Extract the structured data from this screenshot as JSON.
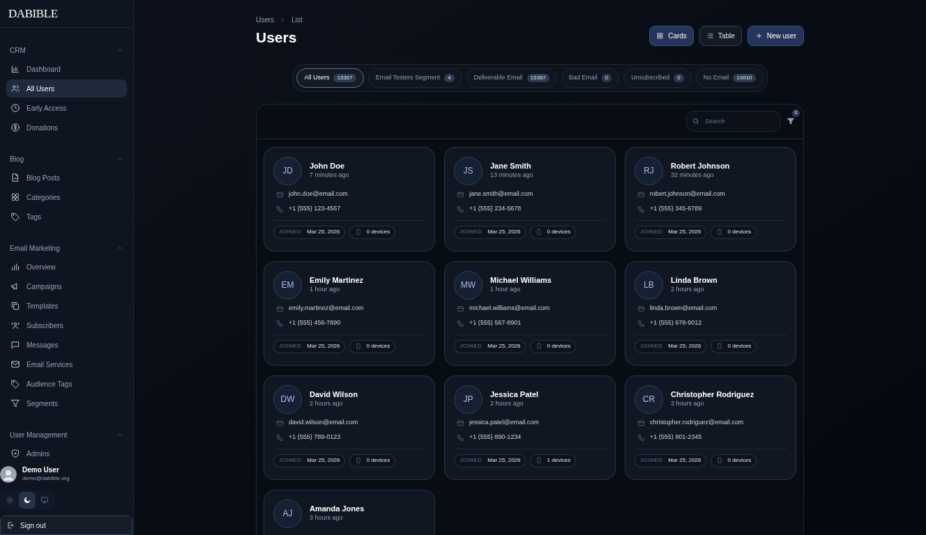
{
  "sidebar": {
    "logo": "DABIBLE",
    "sections": [
      {
        "title": "CRM",
        "expanded": true,
        "items": [
          {
            "label": "Dashboard",
            "selected": false
          },
          {
            "label": "All Users",
            "selected": true
          },
          {
            "label": "Early Access",
            "selected": false
          },
          {
            "label": "Donations",
            "selected": false
          }
        ]
      },
      {
        "title": "Blog",
        "expanded": true,
        "items": [
          {
            "label": "Blog Posts",
            "selected": false
          },
          {
            "label": "Categories",
            "selected": false
          },
          {
            "label": "Tags",
            "selected": false
          }
        ]
      },
      {
        "title": "Email Marketing",
        "expanded": true,
        "items": [
          {
            "label": "Overview",
            "selected": false
          },
          {
            "label": "Campaigns",
            "selected": false
          },
          {
            "label": "Templates",
            "selected": false
          },
          {
            "label": "Subscribers",
            "selected": false
          },
          {
            "label": "Messages",
            "selected": false
          },
          {
            "label": "Email Services",
            "selected": false
          },
          {
            "label": "Audience Tags",
            "selected": false
          },
          {
            "label": "Segments",
            "selected": false
          }
        ]
      },
      {
        "title": "User Management",
        "expanded": true,
        "items": [
          {
            "label": "Admins",
            "selected": false
          }
        ]
      }
    ],
    "user": {
      "name": "Demo User",
      "email": "demo@dabible.org"
    },
    "theme_options": [
      {
        "selected": false
      },
      {
        "selected": true
      },
      {
        "selected": false
      }
    ],
    "sign_out": "Sign out"
  },
  "breadcrumb": [
    "Users",
    "List"
  ],
  "title": "Users",
  "view_buttons": [
    {
      "label": "Cards",
      "selected": true
    },
    {
      "label": "Table",
      "selected": false
    }
  ],
  "new_button": "New user",
  "segments": [
    {
      "label": "All Users",
      "count": "15367",
      "selected": true
    },
    {
      "label": "Email Testers Segment",
      "count": "4",
      "selected": false
    },
    {
      "label": "Deliverable Email",
      "count": "15367",
      "selected": false
    },
    {
      "label": "Bad Email",
      "count": "0",
      "selected": false
    },
    {
      "label": "Unsubscribed",
      "count": "0",
      "selected": false
    },
    {
      "label": "No Email",
      "count": "10010",
      "selected": false
    }
  ],
  "search": {
    "placeholder": "Search"
  },
  "filter_count": "0",
  "users": [
    {
      "initials": "JD",
      "name": "John Doe",
      "time": "7 minutes ago",
      "email": "john.doe@email.com",
      "phone": "+1 (555) 123-4567",
      "joined_label": "JOINED",
      "joined": "Mar 25, 2026",
      "devices": "0 devices"
    },
    {
      "initials": "JS",
      "name": "Jane Smith",
      "time": "13 minutes ago",
      "email": "jane.smith@email.com",
      "phone": "+1 (555) 234-5678",
      "joined_label": "JOINED",
      "joined": "Mar 25, 2026",
      "devices": "0 devices"
    },
    {
      "initials": "RJ",
      "name": "Robert Johnson",
      "time": "32 minutes ago",
      "email": "robert.johnson@email.com",
      "phone": "+1 (555) 345-6789",
      "joined_label": "JOINED",
      "joined": "Mar 25, 2026",
      "devices": "0 devices"
    },
    {
      "initials": "EM",
      "name": "Emily Martinez",
      "time": "1 hour ago",
      "email": "emily.martinez@email.com",
      "phone": "+1 (555) 456-7890",
      "joined_label": "JOINED",
      "joined": "Mar 25, 2026",
      "devices": "0 devices"
    },
    {
      "initials": "MW",
      "name": "Michael Williams",
      "time": "1 hour ago",
      "email": "michael.williams@email.com",
      "phone": "+1 (555) 567-8901",
      "joined_label": "JOINED",
      "joined": "Mar 25, 2026",
      "devices": "0 devices"
    },
    {
      "initials": "LB",
      "name": "Linda Brown",
      "time": "2 hours ago",
      "email": "linda.brown@email.com",
      "phone": "+1 (555) 678-9012",
      "joined_label": "JOINED",
      "joined": "Mar 25, 2026",
      "devices": "0 devices"
    },
    {
      "initials": "DW",
      "name": "David Wilson",
      "time": "2 hours ago",
      "email": "david.wilson@email.com",
      "phone": "+1 (555) 789-0123",
      "joined_label": "JOINED",
      "joined": "Mar 25, 2026",
      "devices": "0 devices"
    },
    {
      "initials": "JP",
      "name": "Jessica Patel",
      "time": "2 hours ago",
      "email": "jessica.patel@email.com",
      "phone": "+1 (555) 890-1234",
      "joined_label": "JOINED",
      "joined": "Mar 25, 2026",
      "devices": "1 devices"
    },
    {
      "initials": "CR",
      "name": "Christopher Rodriguez",
      "time": "3 hours ago",
      "email": "christopher.rodriguez@email.com",
      "phone": "+1 (555) 901-2345",
      "joined_label": "JOINED",
      "joined": "Mar 25, 2026",
      "devices": "0 devices"
    },
    {
      "initials": "AJ",
      "name": "Amanda Jones",
      "time": "3 hours ago"
    }
  ]
}
